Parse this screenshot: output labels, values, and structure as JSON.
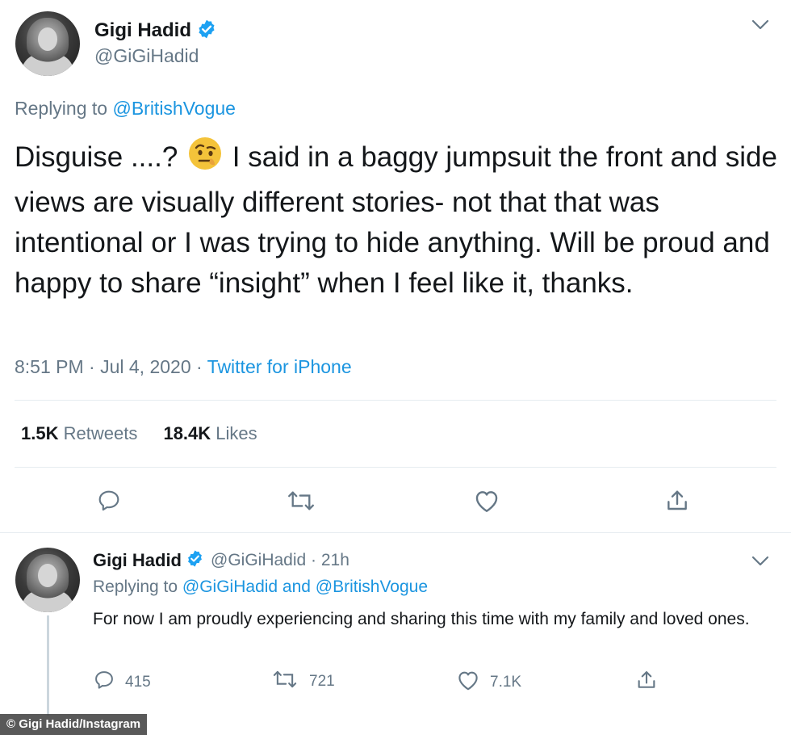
{
  "main_tweet": {
    "display_name": "Gigi Hadid",
    "handle": "@GiGiHadid",
    "replying_prefix": "Replying to",
    "replying_to": "@BritishVogue",
    "text_before_emoji": "Disguise ....?",
    "emoji": "🤨",
    "text_after_emoji": " I said in a baggy jumpsuit the front and side views are visually different stories- not that that was intentional or I was trying to hide anything. Will be proud and happy to share “insight” when I feel like it, thanks.",
    "timestamp": "8:51 PM · Jul 4, 2020 ·",
    "source": "Twitter for iPhone",
    "retweets_count": "1.5K",
    "retweets_label": "Retweets",
    "likes_count": "18.4K",
    "likes_label": "Likes"
  },
  "reply_tweet": {
    "display_name": "Gigi Hadid",
    "handle_time": "@GiGiHadid · 21h",
    "replying_prefix": "Replying to",
    "replying_to": "@GiGiHadid and @BritishVogue",
    "text": "For now I am proudly experiencing and sharing this time with my family and loved ones.",
    "reply_count": "415",
    "retweet_count": "721",
    "like_count": "7.1K"
  },
  "caption": "© Gigi Hadid/Instagram",
  "colors": {
    "accent": "#1b95e0",
    "verified": "#1da1f2",
    "muted": "#657786",
    "divider": "#e6ecf0"
  },
  "icons": [
    "verified-badge-icon",
    "chevron-down-icon",
    "reply-icon",
    "retweet-icon",
    "like-icon",
    "share-icon"
  ]
}
